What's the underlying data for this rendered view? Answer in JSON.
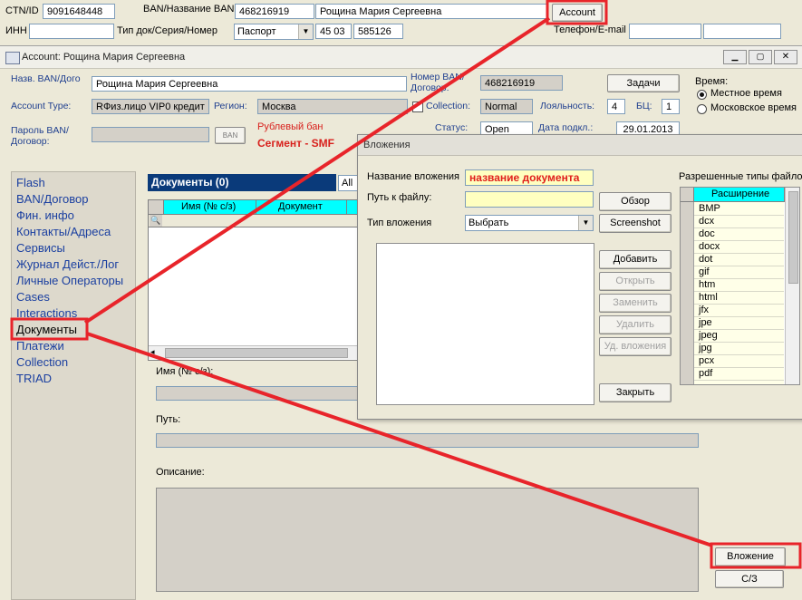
{
  "top": {
    "ctn_label": "CTN/ID",
    "ctn_value": "9091648448",
    "ban_label": "BAN/Название BAN",
    "ban_value": "468216919",
    "ban_name": "Рощина Мария Сергеевна",
    "account_button": "Account",
    "inn_label": "ИНН",
    "doc_type_label": "Тип док/Серия/Номер",
    "doc_type_value": "Паспорт",
    "doc_series": "45 03",
    "doc_number": "585126",
    "phone_label": "Телефон/E-mail"
  },
  "account_window": {
    "title": "Account: Рощина Мария Сергеевна",
    "ban_name_label": "Назв. BAN/Дого",
    "ban_name_value": "Рощина Мария Сергеевна",
    "ban_number_label_1": "Номер BAN/",
    "ban_number_label_2": "Договор:",
    "ban_number_value": "468216919",
    "tasks_button": "Задачи",
    "time_label": "Время:",
    "time_option_local": "Местное время",
    "time_option_moscow": "Московское время",
    "account_type_label": "Account Type:",
    "account_type_value": "RФиз.лицо  VIP0  кредит",
    "region_label": "Регион:",
    "region_value": "Москва",
    "collection_label": "Collection:",
    "collection_value": "Normal",
    "loyalty_label": "Лояльность:",
    "loyalty_value": "4",
    "bc_label": "БЦ:",
    "bc_value": "1",
    "password_label_1": "Пароль BAN/",
    "password_label_2": "Договор:",
    "ban_small_button": "BAN",
    "ruble_ban": "Рублевый бан",
    "segment": "Сегмент - SMF",
    "status_label": "Статус:",
    "status_value": "Open",
    "connect_date_label": "Дата подкл.:",
    "connect_date_value": "29.01.2013"
  },
  "sidebar": {
    "items": [
      "Flash",
      "BAN/Договор",
      "Фин. инфо",
      "Контакты/Адреса",
      "Сервисы",
      "Журнал Дейст./Лог",
      "Личные Операторы",
      "Cases",
      "Interactions",
      "Документы",
      "Платежи",
      "Collection",
      "TRIAD"
    ]
  },
  "documents": {
    "header": "Документы (0)",
    "filter_value": "All",
    "col_name": "Имя (№ с/з)",
    "col_doc": "Документ",
    "name_label": "Имя (№ с/з):",
    "path_label": "Путь:",
    "desc_label": "Описание:",
    "attach_button": "Вложение",
    "sz_button": "С/З"
  },
  "attach_dialog": {
    "title": "Вложения",
    "name_label": "Название вложения",
    "name_value": "название документа",
    "path_label": "Путь к файлу:",
    "type_label": "Тип вложения",
    "type_value": "Выбрать",
    "browse_button": "Обзор",
    "screenshot_button": "Screenshot",
    "add_button": "Добавить",
    "open_button": "Открыть",
    "replace_button": "Заменить",
    "delete_button": "Удалить",
    "delete_attachments_button": "Уд. вложения",
    "close_button": "Закрыть",
    "allowed_types_label": "Разрешенные типы файлов",
    "ext_header": "Расширение",
    "extensions": [
      "BMP",
      "dcx",
      "doc",
      "docx",
      "dot",
      "gif",
      "htm",
      "html",
      "jfx",
      "jpe",
      "jpeg",
      "jpg",
      "pcx",
      "pdf"
    ]
  },
  "colors": {
    "highlight_red": "#e8242a",
    "doc_header_bg": "#0a3a7a",
    "selected_cyan": "#00ffff",
    "label_blue": "#1f3f8f"
  }
}
